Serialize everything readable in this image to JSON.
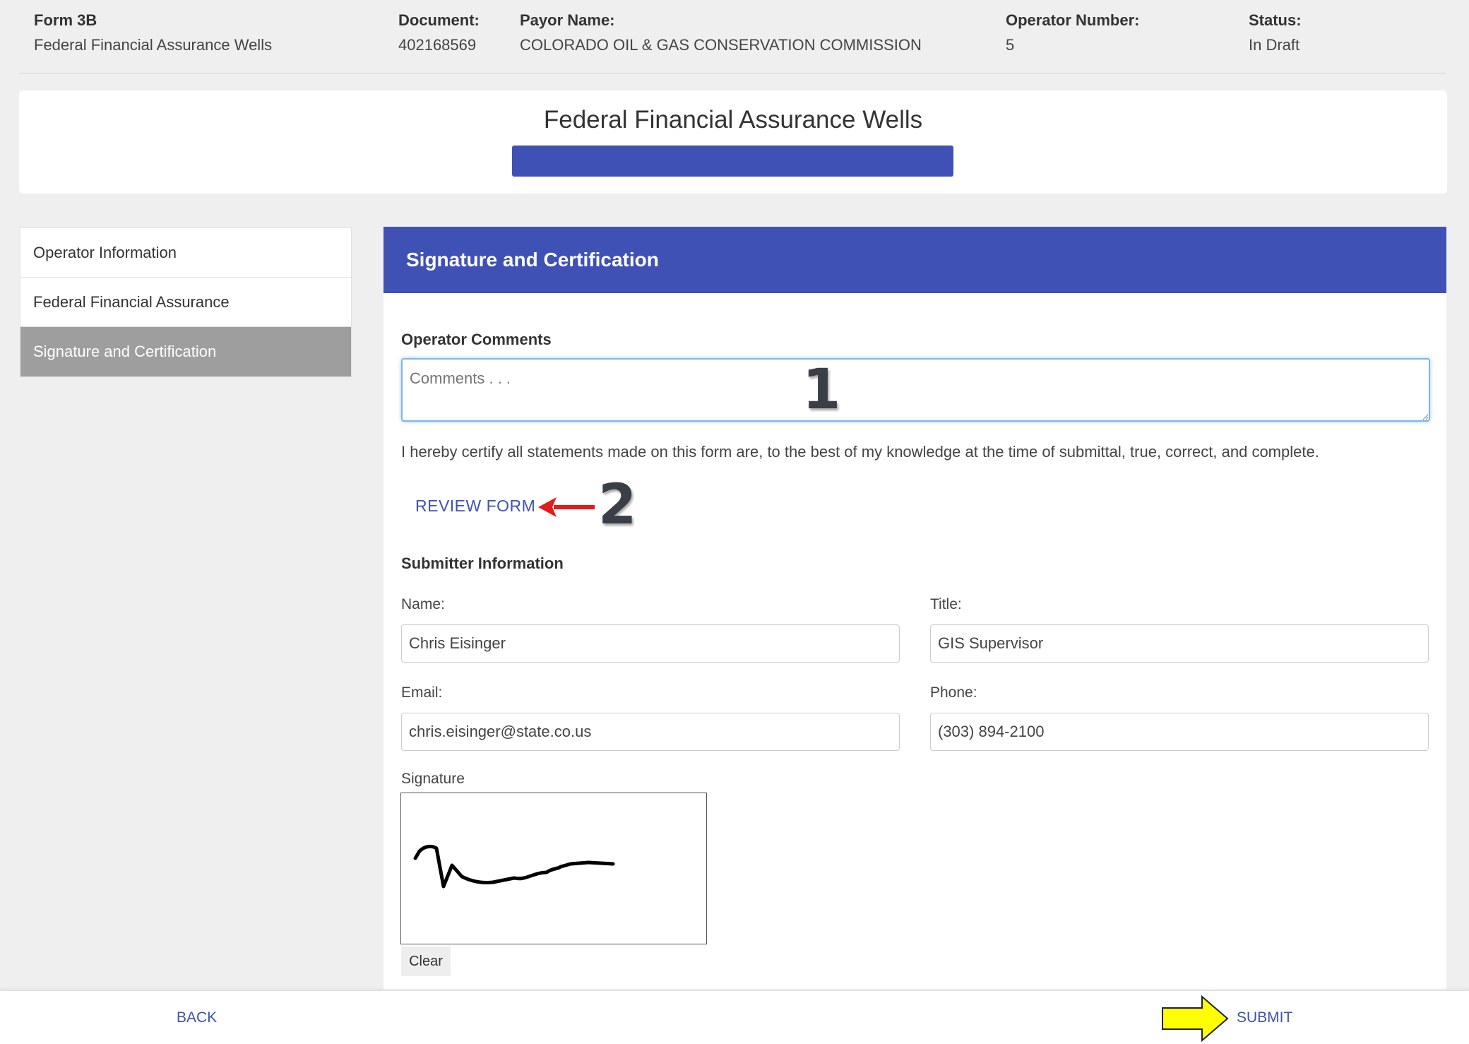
{
  "header": {
    "form": {
      "label": "Form 3B",
      "value": "Federal Financial Assurance Wells"
    },
    "document": {
      "label": "Document:",
      "value": "402168569"
    },
    "payor": {
      "label": "Payor Name:",
      "value": "COLORADO OIL & GAS CONSERVATION COMMISSION"
    },
    "operator": {
      "label": "Operator Number:",
      "value": "5"
    },
    "status": {
      "label": "Status:",
      "value": "In Draft"
    }
  },
  "title": "Federal Financial Assurance Wells",
  "progress": {
    "percent": 100,
    "color": "#3f51b5"
  },
  "sidebar": {
    "items": [
      {
        "label": "Operator Information",
        "active": false
      },
      {
        "label": "Federal Financial Assurance",
        "active": false
      },
      {
        "label": "Signature and Certification",
        "active": true
      }
    ]
  },
  "panel": {
    "heading": "Signature and Certification",
    "comments": {
      "label": "Operator Comments",
      "placeholder": "Comments . . ."
    },
    "certify_text": "I hereby certify all statements made on this form are, to the best of my knowledge at the time of submittal, true, correct, and complete.",
    "review_label": "REVIEW FORM",
    "submitter": {
      "heading": "Submitter Information",
      "name": {
        "label": "Name:",
        "value": "Chris Eisinger"
      },
      "title": {
        "label": "Title:",
        "value": "GIS Supervisor"
      },
      "email": {
        "label": "Email:",
        "value": "chris.eisinger@state.co.us"
      },
      "phone": {
        "label": "Phone:",
        "value": "(303) 894-2100"
      }
    },
    "signature": {
      "label": "Signature",
      "clear_label": "Clear"
    }
  },
  "annotations": {
    "step1": "1",
    "step2": "2"
  },
  "footer": {
    "back_label": "BACK",
    "submit_label": "SUBMIT"
  },
  "colors": {
    "accent": "#3f51b5",
    "arrow_red": "#e31b1b",
    "arrow_yellow": "#ffff00",
    "active_nav": "#9e9e9e"
  }
}
